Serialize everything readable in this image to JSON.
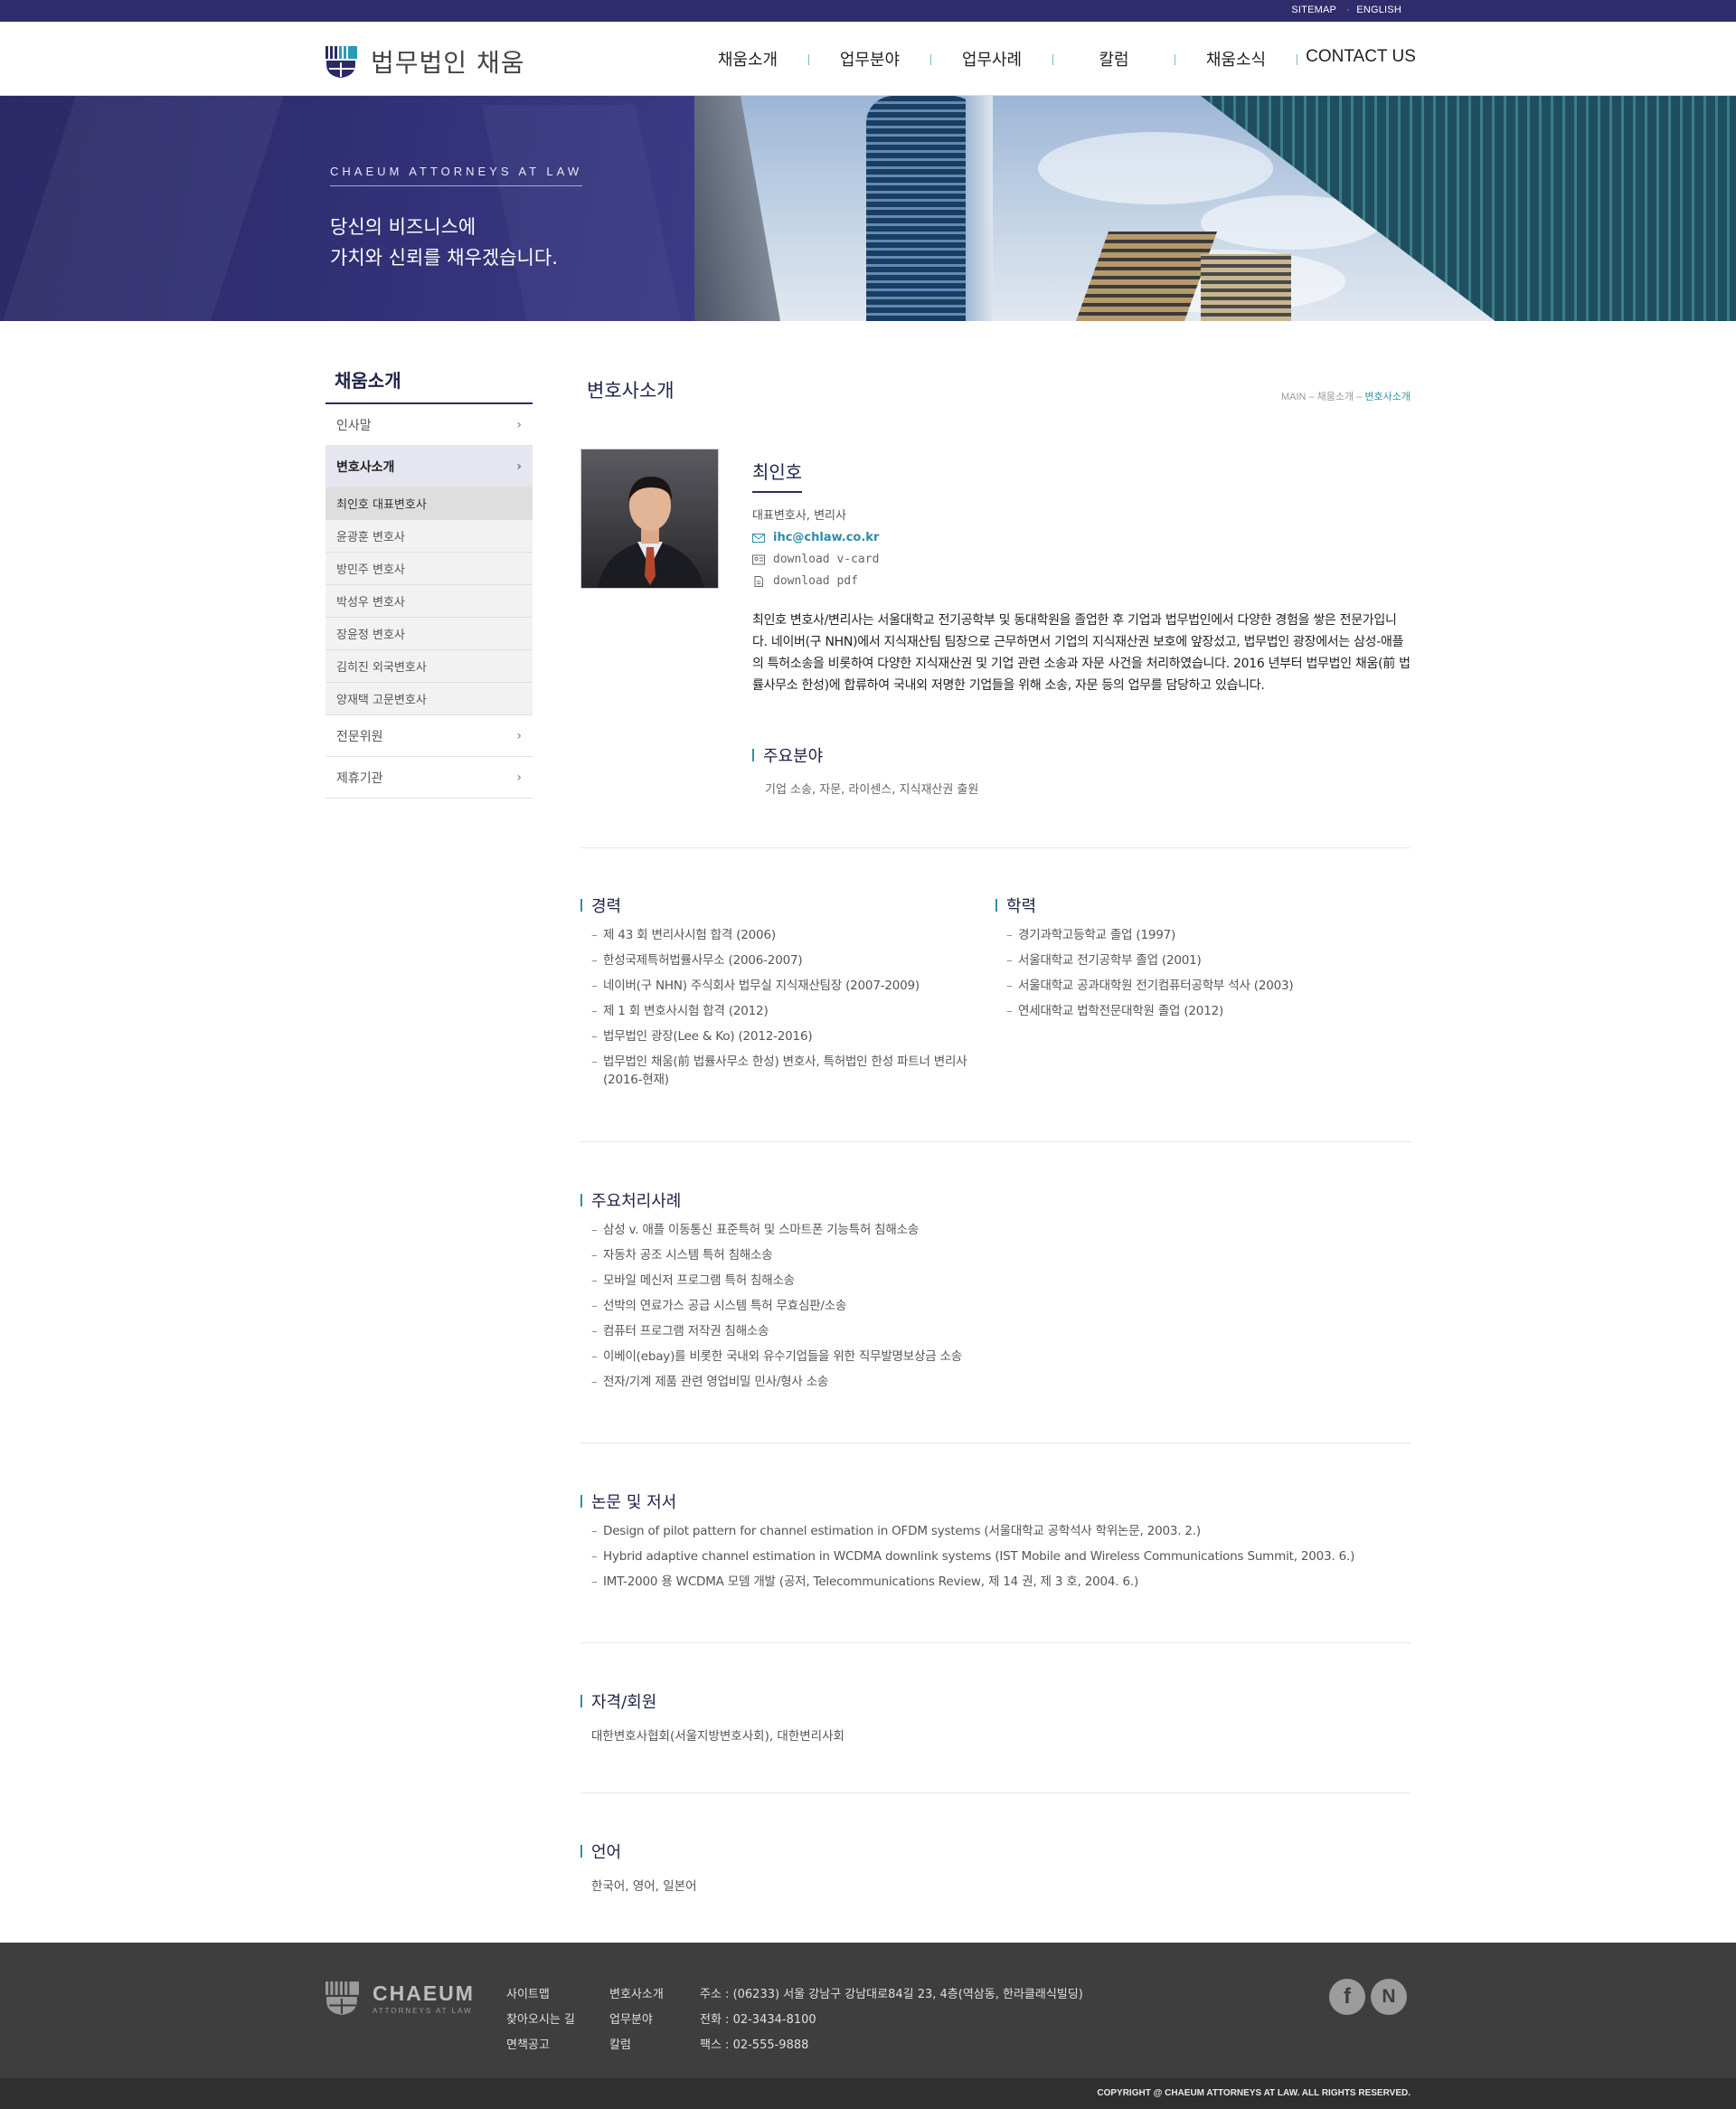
{
  "util_links": [
    "SITEMAP",
    "ENGLISH"
  ],
  "brand": {
    "name": "법무법인 채움"
  },
  "gnb": [
    "채움소개",
    "업무분야",
    "업무사례",
    "칼럼",
    "채움소식",
    "CONTACT US"
  ],
  "hero": {
    "kicker": "CHAEUM ATTORNEYS AT LAW",
    "line1": "당신의 비즈니스에",
    "line2": "가치와 신뢰를 채우겠습니다."
  },
  "lnb": {
    "title": "채움소개",
    "items": [
      {
        "label": "인사말"
      },
      {
        "label": "변호사소개"
      },
      {
        "label": "전문위원"
      },
      {
        "label": "제휴기관"
      }
    ],
    "sub": [
      "최인호 대표변호사",
      "윤광훈 변호사",
      "방민주 변호사",
      "박성우 변호사",
      "장윤정 변호사",
      "김히진 외국변호사",
      "양재택 고문변호사"
    ]
  },
  "page": {
    "title": "변호사소개",
    "crumb": {
      "a": "MAIN",
      "b": "채움소개",
      "c": "변호사소개",
      "sep": " – "
    }
  },
  "profile": {
    "name": "최인호",
    "role": "대표변호사, 변리사",
    "email": "ihc@chlaw.co.kr",
    "vcard": "download v-card",
    "pdf": "download pdf",
    "bio": "최인호 변호사/변리사는 서울대학교 전기공학부 및 동대학원을 졸업한 후 기업과 법무법인에서 다양한 경험을 쌓은 전문가입니다. 네이버(구 NHN)에서 지식재산팀 팀장으로 근무하면서 기업의 지식재산권 보호에 앞장섰고, 법무법인 광장에서는 삼성-애플의 특허소송을 비롯하여 다양한 지식재산권 및 기업 관련 소송과 자문 사건을 처리하였습니다. 2016 년부터 법무법인 채움(前 법률사무소 한성)에 합류하여 국내외 저명한 기업들을 위해 소송, 자문 등의 업무를 담당하고 있습니다."
  },
  "fields": {
    "title": "주요분야",
    "text": "기업 소송, 자문, 라이센스, 지식재산권 출원"
  },
  "career": {
    "title": "경력",
    "items": [
      "제 43 회 변리사시험 합격 (2006)",
      "한성국제특허법률사무소 (2006-2007)",
      "네이버(구 NHN) 주식회사 법무실 지식재산팀장 (2007-2009)",
      "제 1 회 변호사시험 합격 (2012)",
      "법무법인 광장(Lee & Ko) (2012-2016)",
      "법무법인 채움(前 법률사무소 한성) 변호사, 특허법인 한성 파트너 변리사 (2016-현재)"
    ]
  },
  "education": {
    "title": "학력",
    "items": [
      "경기과학고등학교 졸업 (1997)",
      "서울대학교 전기공학부 졸업 (2001)",
      "서울대학교 공과대학원 전기컴퓨터공학부 석사 (2003)",
      "연세대학교 법학전문대학원 졸업 (2012)"
    ]
  },
  "cases": {
    "title": "주요처리사례",
    "items": [
      "삼성 v. 애플 이동통신 표준특허 및 스마트폰 기능특허 침해소송",
      "자동차 공조 시스템 특허 침해소송",
      "모바일 메신저 프로그램 특허 침해소송",
      "선박의 연료가스 공급 시스템 특허 무효심판/소송",
      "컴퓨터 프로그램 저작권 침해소송",
      "이베이(ebay)를 비롯한 국내외 유수기업들을 위한 직무발명보상금 소송",
      "전자/기계 제품 관련 영업비밀 민사/형사 소송"
    ]
  },
  "papers": {
    "title": "논문 및 저서",
    "items": [
      "Design of pilot pattern for channel estimation in OFDM systems (서울대학교 공학석사 학위논문, 2003. 2.)",
      "Hybrid adaptive channel estimation in WCDMA downlink systems (IST Mobile and Wireless Communications Summit, 2003. 6.)",
      "IMT-2000 용 WCDMA 모뎀 개발 (공저, Telecommunications Review, 제 14 권, 제 3 호, 2004. 6.)"
    ]
  },
  "membership": {
    "title": "자격/회원",
    "text": "대한변호사협회(서울지방변호사회), 대한변리사회"
  },
  "language": {
    "title": "언어",
    "text": "한국어, 영어, 일본어"
  },
  "footer": {
    "logo_big": "CHAEUM",
    "logo_small": "ATTORNEYS AT LAW",
    "col1": [
      "사이트맵",
      "찾아오시는 길",
      "면책공고"
    ],
    "col2": [
      "변호사소개",
      "업무분야",
      "칼럼"
    ],
    "addr": "주소 : (06233) 서울 강남구 강남대로84길 23, 4층(역삼동, 한라클래식빌딩)",
    "tel": "전화 : 02-3434-8100",
    "fax": "팩스 : 02-555-9888",
    "social": [
      "f",
      "N"
    ],
    "copyright": "COPYRIGHT @ CHAEUM ATTORNEYS AT LAW. ALL RIGHTS RESERVED."
  },
  "colors": {
    "navy": "#302c6b",
    "accent": "#2c8fa8",
    "footer": "#3e3e3e"
  }
}
